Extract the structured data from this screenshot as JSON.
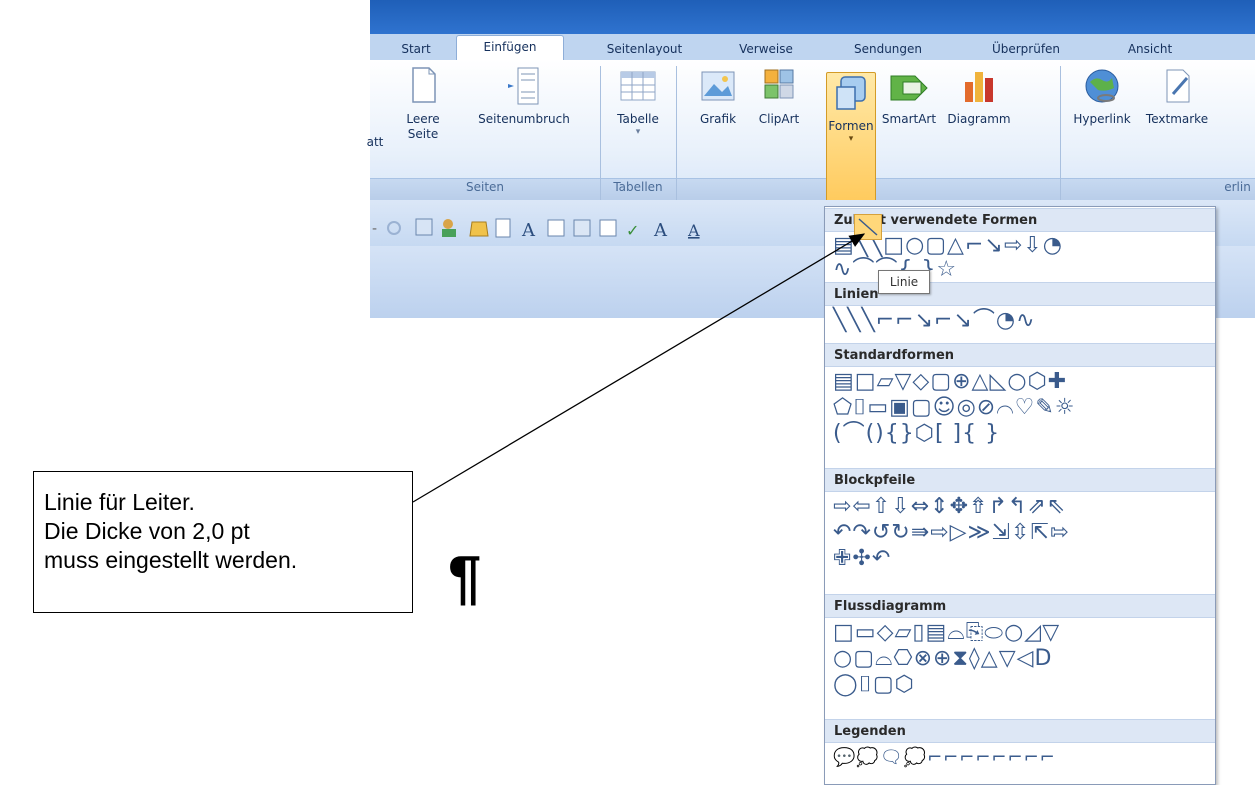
{
  "ribbon": {
    "tabs": [
      "Start",
      "Einfügen",
      "Seitenlayout",
      "Verweise",
      "Sendungen",
      "Überprüfen",
      "Ansicht"
    ],
    "active_tab": "Einfügen",
    "buttons": {
      "blatt": "att",
      "leere_seite": "Leere Seite",
      "seitenumbruch": "Seitenumbruch",
      "tabelle": "Tabelle",
      "grafik": "Grafik",
      "clipart": "ClipArt",
      "formen": "Formen",
      "smartart": "SmartArt",
      "diagramm": "Diagramm",
      "hyperlink": "Hyperlink",
      "textmarke": "Textmarke"
    },
    "groups": {
      "seiten": "Seiten",
      "tabellen": "Tabellen",
      "hyperlinks": "erlin"
    }
  },
  "shapes_menu": {
    "categories": {
      "recent": "Zuletzt verwendete Formen",
      "linien": "Linien",
      "standard": "Standardformen",
      "blockpfeile": "Blockpfeile",
      "fluss": "Flussdiagramm",
      "legenden": "Legenden"
    },
    "rows": {
      "recent_1": "▤╲╲□○▢△⌐↘⇨⇩◔",
      "recent_2": "∿⌒⌒{ }☆",
      "linien_1": "╲╲╲⌐⌐↘⌐↘⌒◔∿",
      "standard_1": "▤□▱▽◇▢⊕△◺○⬡✚",
      "standard_2": "⬠⌷▭▣▢☺◎⊘⌒♡✎☼",
      "standard_3": "(⌒(){}⬡[ ]{ }",
      "block_1": "⇨⇦⇧⇩⇔⇕✥⇮↱↰⇗⇖",
      "block_2": "↶↷↺↻⇛⇨▷≫⇲⇳⇱⇰",
      "block_3": "✙✣↶",
      "fluss_1": "□▭◇▱▯▤⌓⎘⬭○◿▽",
      "fluss_2": "○▢⌓⎔⊗⊕⧗◊△▽◁D",
      "fluss_3": "◯⌷▢⬡",
      "legenden_1": "💬💭🗨💭⌐⌐⌐⌐⌐⌐⌐⌐"
    },
    "tooltip": "Linie",
    "hover_label": "Linie"
  },
  "callout": {
    "line1": "Linie für Leiter.",
    "line2": "Die Dicke von 2,0 pt",
    "line3": "muss eingestellt werden."
  },
  "document": {
    "pilcrow": "¶"
  }
}
